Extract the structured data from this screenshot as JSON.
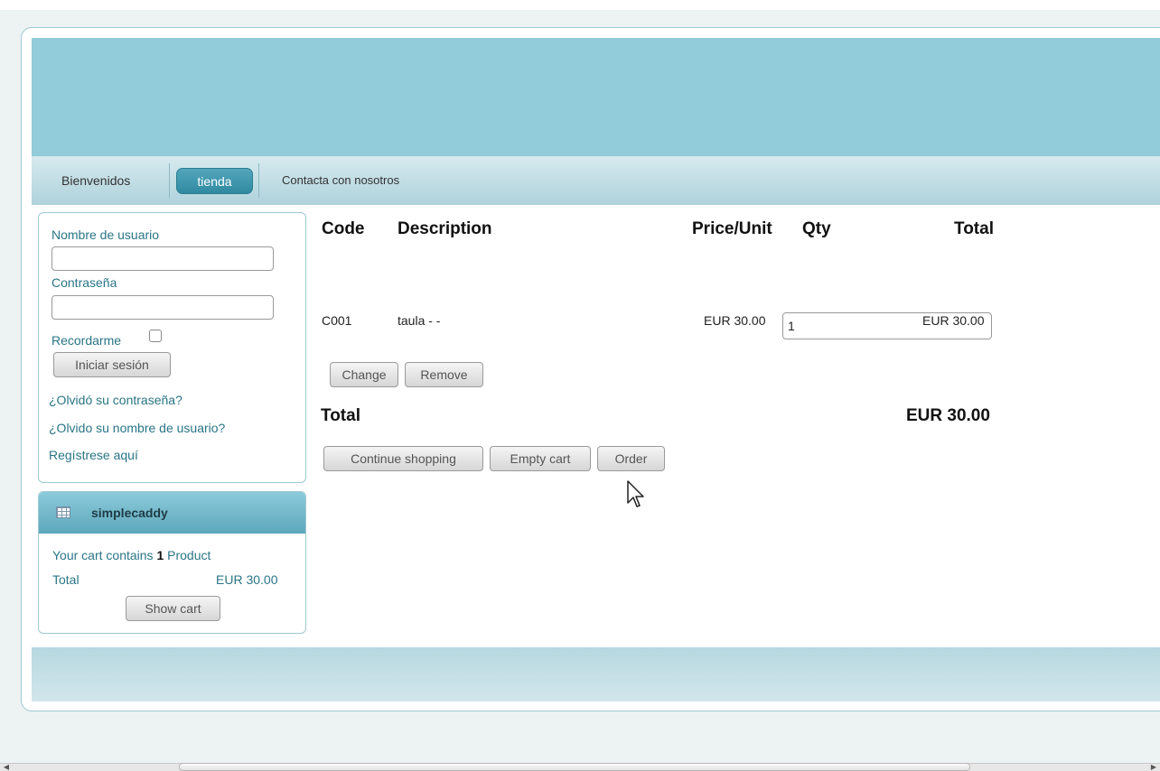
{
  "nav": {
    "items": [
      "Bienvenidos",
      "tienda",
      "Contacta con nosotros"
    ]
  },
  "login": {
    "username_label": "Nombre de usuario",
    "username_value": "",
    "password_label": "Contraseña",
    "password_value": "",
    "remember_label": "Recordarme",
    "login_button": "Iniciar sesión",
    "links": [
      "¿Olvidó su contraseña?",
      "¿Olvido su nombre de usuario?",
      "Regístrese aquí"
    ]
  },
  "caddy": {
    "title": "simplecaddy",
    "icon": "table-icon",
    "cart_prefix": "Your cart contains",
    "cart_count": "1",
    "cart_suffix": "Product",
    "total_label": "Total",
    "total_value": "EUR 30.00",
    "show_cart_button": "Show cart"
  },
  "cart": {
    "headers": {
      "code": "Code",
      "description": "Description",
      "price": "Price/Unit",
      "qty": "Qty",
      "total": "Total"
    },
    "rows": [
      {
        "code": "C001",
        "description": "taula - -",
        "price": "EUR 30.00",
        "qty": "1",
        "total": "EUR 30.00"
      }
    ],
    "change_button": "Change",
    "remove_button": "Remove",
    "grand_total_label": "Total",
    "grand_total_value": "EUR 30.00",
    "continue_button": "Continue shopping",
    "empty_button": "Empty cart",
    "order_button": "Order"
  },
  "colors": {
    "banner": "#92cbd9",
    "accent": "#2f8aa1",
    "link": "#2a7586"
  }
}
